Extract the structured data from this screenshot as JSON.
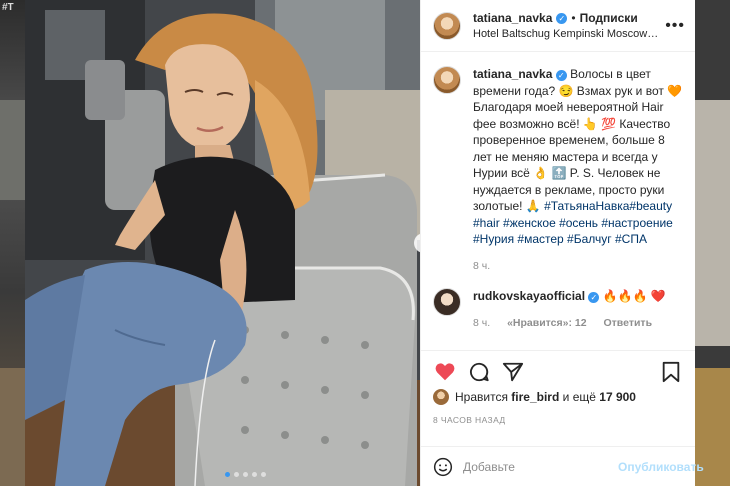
{
  "backdrop": {
    "corner_text": "#T"
  },
  "post": {
    "author": {
      "username": "tatiana_navka",
      "follow_label": "Подписки",
      "separator": "•",
      "location": "Hotel Baltschug Kempinski Moscow Отель..."
    },
    "more_label": "•••",
    "carousel": {
      "next_label": "›",
      "count": 5,
      "active_index": 0
    },
    "caption": {
      "username": "tatiana_navka",
      "text": "Волосы в цвет времени года? 😏 Взмах рук и вот 🧡 Благодаря моей невероятной Hair фее возможно всё! 👆 💯 Качество проверенное временем, больше 8 лет не меняю мастера и всегда у Нурии всё 👌 🔝 P. S. Человек не нуждается в рекламе, просто руки золотые! 🙏",
      "hashtags": "#ТатьянаНавка#beauty #hair #женское #осень #настроение #Нурия #мастер #Балчуг #СПА",
      "time": "8 ч."
    },
    "comments": [
      {
        "username": "rudkovskayaofficial",
        "text": "🔥🔥🔥 ❤️",
        "time": "8 ч.",
        "likes": "«Нравится»: 12",
        "reply_label": "Ответить"
      }
    ],
    "likes": {
      "prefix": "Нравится",
      "user": "fire_bird",
      "suffix": "и ещё",
      "count": "17 900"
    },
    "timestamp": "8 ЧАСОВ НАЗАД",
    "add_comment": {
      "placeholder": "Добавьте",
      "publish_label": "Опубликовать"
    },
    "icons": {
      "like": "heart-filled-icon",
      "comment": "comment-icon",
      "share": "share-icon",
      "save": "bookmark-icon",
      "emoji": "emoji-icon",
      "comment_like": "heart-outline-icon",
      "verified": "verified-badge-icon"
    },
    "colors": {
      "like_red": "#ed4956",
      "link_blue": "#003569",
      "verified_blue": "#3897f0",
      "publish_disabled": "#b2dffc"
    }
  }
}
